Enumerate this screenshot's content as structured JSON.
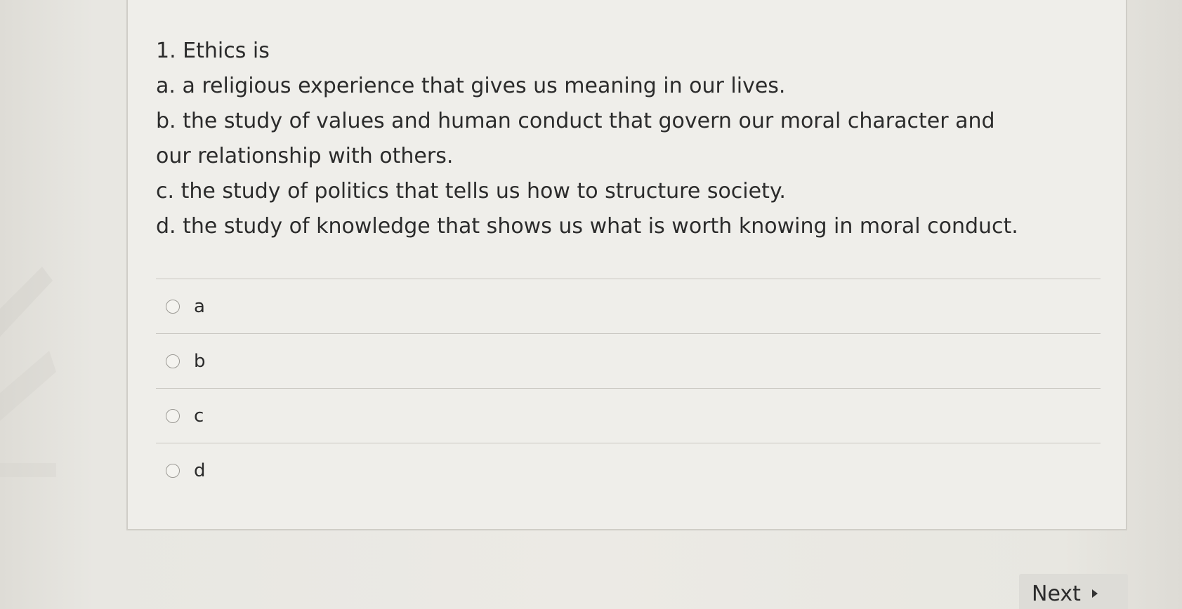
{
  "question": {
    "stem": "1. Ethics is",
    "choices_text": [
      "a. a religious experience that gives us meaning in our lives.",
      "b. the study of values and human conduct that govern our moral character and our relationship with others.",
      "c. the study of politics that tells us how to structure society.",
      "d. the study of knowledge that shows us what is worth knowing in moral conduct."
    ]
  },
  "options": [
    {
      "label": "a"
    },
    {
      "label": "b"
    },
    {
      "label": "c"
    },
    {
      "label": "d"
    }
  ],
  "navigation": {
    "next_label": "Next"
  },
  "icons": {
    "next": "caret-right-icon"
  }
}
